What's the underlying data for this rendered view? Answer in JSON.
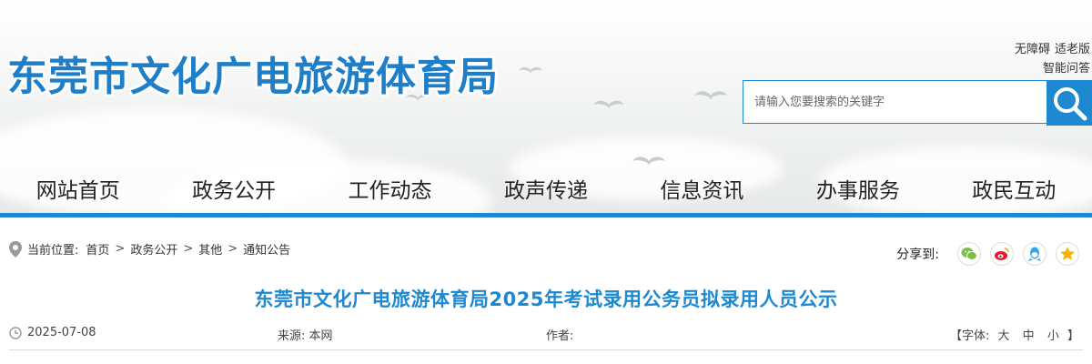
{
  "header": {
    "site_title": "东莞市文化广电旅游体育局",
    "accessibility_link": "无障碍",
    "elderly_link": "适老版",
    "qa_link": "智能问答",
    "search": {
      "placeholder": "请输入您要搜索的关键字"
    }
  },
  "nav": {
    "items": [
      {
        "label": "网站首页"
      },
      {
        "label": "政务公开"
      },
      {
        "label": "工作动态"
      },
      {
        "label": "政声传递"
      },
      {
        "label": "信息资讯"
      },
      {
        "label": "办事服务"
      },
      {
        "label": "政民互动"
      }
    ]
  },
  "breadcrumb": {
    "prefix": "当前位置:",
    "items": [
      "首页",
      "政务公开",
      "其他",
      "通知公告"
    ],
    "separator": ">"
  },
  "share": {
    "label": "分享到:",
    "icons": [
      "wechat-icon",
      "weibo-icon",
      "qq-icon",
      "qzone-icon"
    ]
  },
  "article": {
    "title": "东莞市文化广电旅游体育局2025年考试录用公务员拟录用人员公示",
    "date": "2025-07-08",
    "source_label": "来源:",
    "source_value": "本网",
    "author_label": "作者:",
    "font_prefix": "【字体:",
    "font_large": "大",
    "font_medium": "中",
    "font_small": "小",
    "font_suffix": "】"
  },
  "colors": {
    "brand_blue": "#1e88d0",
    "title_blue": "#1e7ec8",
    "wechat_green": "#7ac143",
    "weibo_red": "#e6162d",
    "qq_blue": "#2ea8e6",
    "qzone_yellow": "#f5b400"
  }
}
